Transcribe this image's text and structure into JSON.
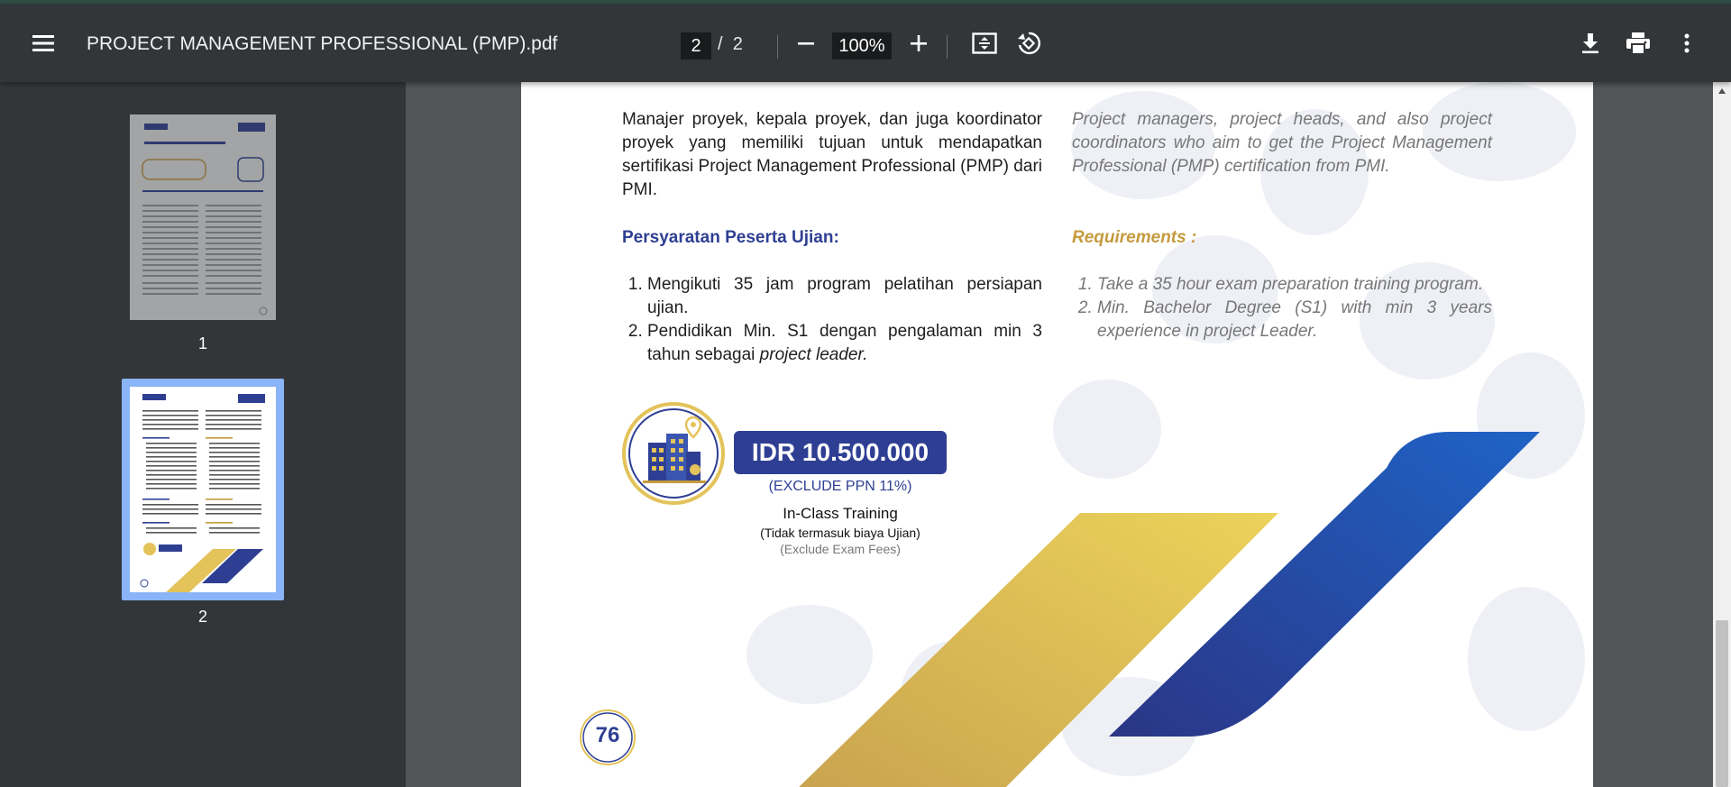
{
  "app": {
    "file_title": "PROJECT MANAGEMENT PROFESSIONAL (PMP).pdf",
    "current_page": "2",
    "page_separator": "/",
    "total_pages": "2",
    "zoom": "100%"
  },
  "toolbar": {
    "menu_icon": "menu-icon",
    "zoom_out_icon": "minus-icon",
    "zoom_in_icon": "plus-icon",
    "fit_icon": "fit-page-icon",
    "rotate_icon": "rotate-icon",
    "download_icon": "download-icon",
    "print_icon": "print-icon",
    "more_icon": "more-vert-icon"
  },
  "sidebar": {
    "thumbnails": [
      {
        "label": "1",
        "selected": false
      },
      {
        "label": "2",
        "selected": true
      }
    ]
  },
  "document": {
    "intro_id": "Manajer proyek, kepala proyek, dan juga koordinator proyek yang memiliki tujuan untuk mendapatkan sertifikasi Project Management Professional (PMP) dari PMI.",
    "intro_en": "Project managers, project heads, and also project coordinators who aim to get the Project Management Professional (PMP) certification from PMI.",
    "heading_id": "Persyaratan Peserta Ujian:",
    "heading_en": "Requirements  :",
    "req_id_1": "Mengikuti 35 jam program pelatihan persiapan ujian.",
    "req_id_2_a": "Pendidikan Min. S1 dengan pengalaman min 3 tahun sebagai ",
    "req_id_2_b": "project leader.",
    "req_en_1": "Take a 35 hour exam preparation training program.",
    "req_en_2": "Min. Bachelor Degree (S1) with min 3 years experience in project Leader.",
    "price": "IDR 10.500.000",
    "price_note": "(EXCLUDE PPN 11%)",
    "training_type": "In-Class Training",
    "fee_note_id": "(Tidak termasuk biaya Ujian)",
    "fee_note_en": "(Exclude Exam Fees)",
    "page_number": "76"
  },
  "colors": {
    "brand_blue": "#2e3f93",
    "brand_gold": "#e3c35a",
    "toolbar_bg": "#323639",
    "viewer_bg": "#525659",
    "selected_thumb": "#8ab4f8"
  }
}
